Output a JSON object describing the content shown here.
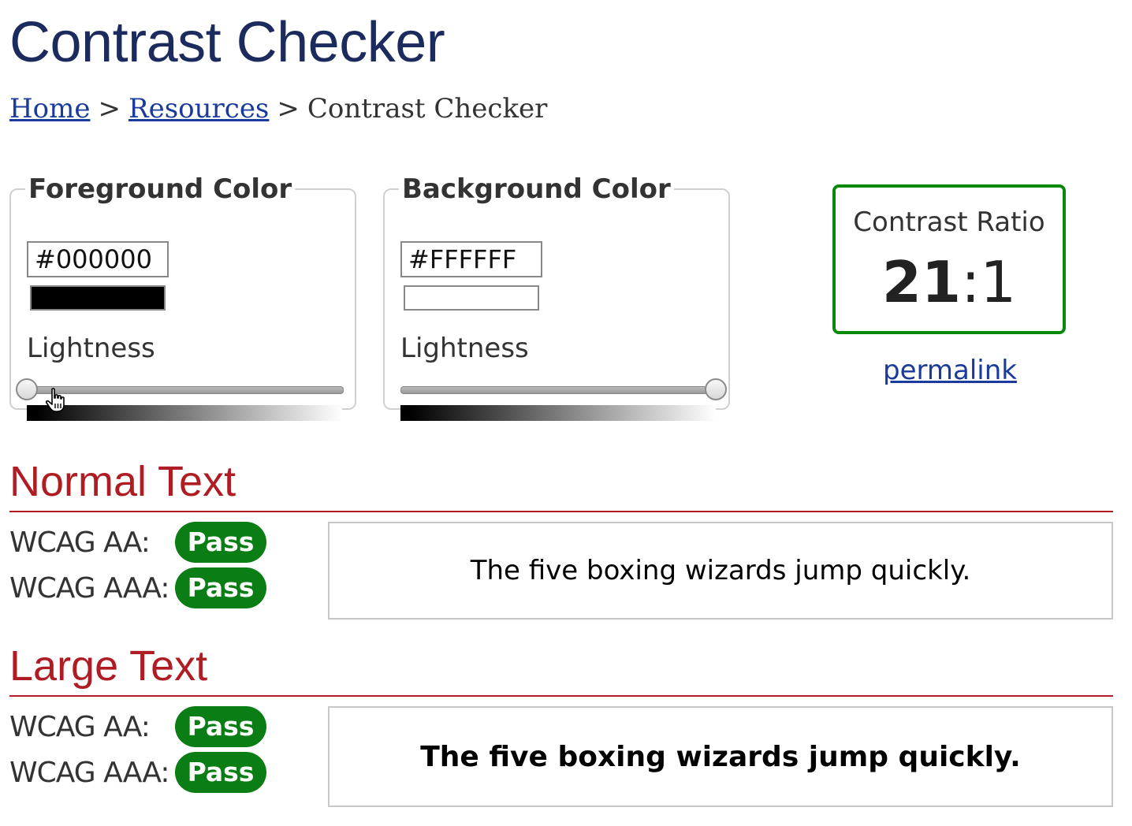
{
  "page": {
    "title": "Contrast Checker"
  },
  "breadcrumb": {
    "home": "Home",
    "sep1": ">",
    "resources": "Resources",
    "sep2": ">",
    "current": "Contrast Checker"
  },
  "foreground": {
    "legend": "Foreground Color",
    "hex": "#000000",
    "swatch_color": "#000000",
    "lightness_label": "Lightness",
    "lightness": 0
  },
  "background": {
    "legend": "Background Color",
    "hex": "#FFFFFF",
    "swatch_color": "#FFFFFF",
    "lightness_label": "Lightness",
    "lightness": 1
  },
  "contrast": {
    "label": "Contrast Ratio",
    "ratio_left": "21",
    "ratio_sep": ":",
    "ratio_right": "1",
    "permalink": "permalink"
  },
  "normal_text": {
    "title": "Normal Text",
    "aa_label": "WCAG AA:",
    "aa_result": "Pass",
    "aaa_label": "WCAG AAA:",
    "aaa_result": "Pass",
    "sample": "The five boxing wizards jump quickly."
  },
  "large_text": {
    "title": "Large Text",
    "aa_label": "WCAG AA:",
    "aa_result": "Pass",
    "aaa_label": "WCAG AAA:",
    "aaa_result": "Pass",
    "sample": "The five boxing wizards jump quickly."
  },
  "colors": {
    "pass": "#0a7d14",
    "heading": "#b01c24",
    "title": "#1c2b5e",
    "link": "#1a3a9c"
  }
}
